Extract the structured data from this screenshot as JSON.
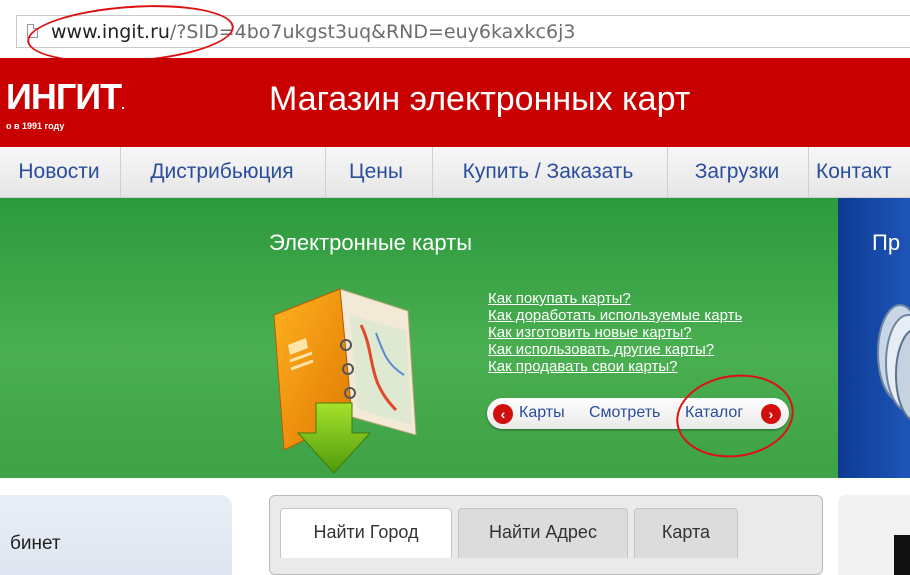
{
  "address_bar": {
    "domain": "www.ingit.ru",
    "path": "/?SID=4bo7ukgst3uq&RND=euy6kaxkc6j3"
  },
  "header": {
    "logo_text": "ИНГИТ",
    "logo_dot": ".",
    "logo_sub": "о в 1991 году",
    "title": "Магазин электронных карт"
  },
  "nav": {
    "items": [
      "Новости",
      "Дистрибьюция",
      "Цены",
      "Купить / Заказать",
      "Загрузки",
      "Контакт"
    ]
  },
  "banner": {
    "title": "Электронные карты",
    "links": [
      "Как покупать карты?",
      "Как доработать используемые карть",
      "Как изготовить новые карты?",
      "Как использовать другие карты?",
      "Как продавать свои карты?"
    ],
    "pill": {
      "left_arrow": "‹",
      "maps_label": "Карты",
      "view_label": "Смотреть",
      "catalog_label": "Каталог",
      "right_arrow": "›"
    }
  },
  "right_panel": {
    "title": "Пр"
  },
  "bottom": {
    "cabinet_label": "бинет",
    "tabs": [
      "Найти Город",
      "Найти Адрес",
      "Карта"
    ]
  },
  "colors": {
    "header_red": "#c80000",
    "banner_green": "#4aaf50",
    "link_blue": "#2a4e9c",
    "panel_blue": "#0d3a93",
    "annotation_red": "#dd1111"
  }
}
